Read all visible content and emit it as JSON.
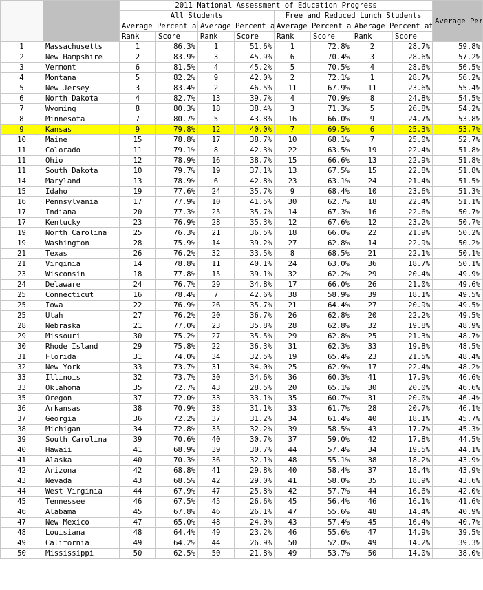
{
  "title": "2011 National Assessment of Education Progress",
  "groups": {
    "all": "All Students",
    "frl": "Free and Reduced Lunch Students",
    "avg": "Average Percent at Benchmark"
  },
  "metrics": {
    "all_basic": "Average Percent at Basic",
    "all_prof": "Average Percent at Proficient",
    "frl_basic": "Average Percent at Basic",
    "frl_prof": "Aberage Percent at Proficient"
  },
  "subheads": {
    "rank": "Rank",
    "score": "Score"
  },
  "highlight_color": "#ffff00",
  "rows": [
    {
      "rank": "1",
      "state": "Massachusetts",
      "r1": "1",
      "s1": "86.3%",
      "r2": "1",
      "s2": "51.6%",
      "r3": "1",
      "s3": "72.8%",
      "r4": "2",
      "s4": "28.7%",
      "avg": "59.8%"
    },
    {
      "rank": "2",
      "state": "New Hampshire",
      "r1": "2",
      "s1": "83.9%",
      "r2": "3",
      "s2": "45.9%",
      "r3": "6",
      "s3": "70.4%",
      "r4": "3",
      "s4": "28.6%",
      "avg": "57.2%"
    },
    {
      "rank": "3",
      "state": "Vermont",
      "r1": "6",
      "s1": "81.5%",
      "r2": "4",
      "s2": "45.2%",
      "r3": "5",
      "s3": "70.5%",
      "r4": "4",
      "s4": "28.6%",
      "avg": "56.5%"
    },
    {
      "rank": "4",
      "state": "Montana",
      "r1": "5",
      "s1": "82.2%",
      "r2": "9",
      "s2": "42.0%",
      "r3": "2",
      "s3": "72.1%",
      "r4": "1",
      "s4": "28.7%",
      "avg": "56.2%"
    },
    {
      "rank": "5",
      "state": "New Jersey",
      "r1": "3",
      "s1": "83.4%",
      "r2": "2",
      "s2": "46.5%",
      "r3": "11",
      "s3": "67.9%",
      "r4": "11",
      "s4": "23.6%",
      "avg": "55.4%"
    },
    {
      "rank": "6",
      "state": "North Dakota",
      "r1": "4",
      "s1": "82.7%",
      "r2": "13",
      "s2": "39.7%",
      "r3": "4",
      "s3": "70.9%",
      "r4": "8",
      "s4": "24.8%",
      "avg": "54.5%"
    },
    {
      "rank": "7",
      "state": "Wyoming",
      "r1": "8",
      "s1": "80.3%",
      "r2": "18",
      "s2": "38.4%",
      "r3": "3",
      "s3": "71.3%",
      "r4": "5",
      "s4": "26.8%",
      "avg": "54.2%"
    },
    {
      "rank": "8",
      "state": "Minnesota",
      "r1": "7",
      "s1": "80.7%",
      "r2": "5",
      "s2": "43.8%",
      "r3": "16",
      "s3": "66.0%",
      "r4": "9",
      "s4": "24.7%",
      "avg": "53.8%"
    },
    {
      "rank": "9",
      "state": "Kansas",
      "r1": "9",
      "s1": "79.8%",
      "r2": "12",
      "s2": "40.0%",
      "r3": "7",
      "s3": "69.5%",
      "r4": "6",
      "s4": "25.3%",
      "avg": "53.7%",
      "highlight": true
    },
    {
      "rank": "10",
      "state": "Maine",
      "r1": "15",
      "s1": "78.8%",
      "r2": "17",
      "s2": "38.7%",
      "r3": "10",
      "s3": "68.1%",
      "r4": "7",
      "s4": "25.0%",
      "avg": "52.7%"
    },
    {
      "rank": "11",
      "state": "Colorado",
      "r1": "11",
      "s1": "79.1%",
      "r2": "8",
      "s2": "42.3%",
      "r3": "22",
      "s3": "63.5%",
      "r4": "19",
      "s4": "22.4%",
      "avg": "51.8%"
    },
    {
      "rank": "11",
      "state": "Ohio",
      "r1": "12",
      "s1": "78.9%",
      "r2": "16",
      "s2": "38.7%",
      "r3": "15",
      "s3": "66.6%",
      "r4": "13",
      "s4": "22.9%",
      "avg": "51.8%"
    },
    {
      "rank": "11",
      "state": "South Dakota",
      "r1": "10",
      "s1": "79.7%",
      "r2": "19",
      "s2": "37.1%",
      "r3": "13",
      "s3": "67.5%",
      "r4": "15",
      "s4": "22.8%",
      "avg": "51.8%"
    },
    {
      "rank": "14",
      "state": "Maryland",
      "r1": "13",
      "s1": "78.9%",
      "r2": "6",
      "s2": "42.8%",
      "r3": "23",
      "s3": "63.1%",
      "r4": "24",
      "s4": "21.4%",
      "avg": "51.5%"
    },
    {
      "rank": "15",
      "state": "Idaho",
      "r1": "19",
      "s1": "77.6%",
      "r2": "24",
      "s2": "35.7%",
      "r3": "9",
      "s3": "68.4%",
      "r4": "10",
      "s4": "23.6%",
      "avg": "51.3%"
    },
    {
      "rank": "16",
      "state": "Pennsylvania",
      "r1": "17",
      "s1": "77.9%",
      "r2": "10",
      "s2": "41.5%",
      "r3": "30",
      "s3": "62.7%",
      "r4": "18",
      "s4": "22.4%",
      "avg": "51.1%"
    },
    {
      "rank": "17",
      "state": "Indiana",
      "r1": "20",
      "s1": "77.3%",
      "r2": "25",
      "s2": "35.7%",
      "r3": "14",
      "s3": "67.3%",
      "r4": "16",
      "s4": "22.6%",
      "avg": "50.7%"
    },
    {
      "rank": "17",
      "state": "Kentucky",
      "r1": "23",
      "s1": "76.9%",
      "r2": "28",
      "s2": "35.3%",
      "r3": "12",
      "s3": "67.6%",
      "r4": "12",
      "s4": "23.2%",
      "avg": "50.7%"
    },
    {
      "rank": "19",
      "state": "North Carolina",
      "r1": "25",
      "s1": "76.3%",
      "r2": "21",
      "s2": "36.5%",
      "r3": "18",
      "s3": "66.0%",
      "r4": "22",
      "s4": "21.9%",
      "avg": "50.2%"
    },
    {
      "rank": "19",
      "state": "Washington",
      "r1": "28",
      "s1": "75.9%",
      "r2": "14",
      "s2": "39.2%",
      "r3": "27",
      "s3": "62.8%",
      "r4": "14",
      "s4": "22.9%",
      "avg": "50.2%"
    },
    {
      "rank": "21",
      "state": "Texas",
      "r1": "26",
      "s1": "76.2%",
      "r2": "32",
      "s2": "33.5%",
      "r3": "8",
      "s3": "68.5%",
      "r4": "21",
      "s4": "22.1%",
      "avg": "50.1%"
    },
    {
      "rank": "21",
      "state": "Virginia",
      "r1": "14",
      "s1": "78.8%",
      "r2": "11",
      "s2": "40.1%",
      "r3": "24",
      "s3": "63.0%",
      "r4": "36",
      "s4": "18.7%",
      "avg": "50.1%"
    },
    {
      "rank": "23",
      "state": "Wisconsin",
      "r1": "18",
      "s1": "77.8%",
      "r2": "15",
      "s2": "39.1%",
      "r3": "32",
      "s3": "62.2%",
      "r4": "29",
      "s4": "20.4%",
      "avg": "49.9%"
    },
    {
      "rank": "24",
      "state": "Delaware",
      "r1": "24",
      "s1": "76.7%",
      "r2": "29",
      "s2": "34.8%",
      "r3": "17",
      "s3": "66.0%",
      "r4": "26",
      "s4": "21.0%",
      "avg": "49.6%"
    },
    {
      "rank": "25",
      "state": "Connecticut",
      "r1": "16",
      "s1": "78.4%",
      "r2": "7",
      "s2": "42.6%",
      "r3": "38",
      "s3": "58.9%",
      "r4": "39",
      "s4": "18.1%",
      "avg": "49.5%"
    },
    {
      "rank": "25",
      "state": "Iowa",
      "r1": "22",
      "s1": "76.9%",
      "r2": "26",
      "s2": "35.7%",
      "r3": "21",
      "s3": "64.4%",
      "r4": "27",
      "s4": "20.9%",
      "avg": "49.5%"
    },
    {
      "rank": "25",
      "state": "Utah",
      "r1": "27",
      "s1": "76.2%",
      "r2": "20",
      "s2": "36.7%",
      "r3": "26",
      "s3": "62.8%",
      "r4": "20",
      "s4": "22.2%",
      "avg": "49.5%"
    },
    {
      "rank": "28",
      "state": "Nebraska",
      "r1": "21",
      "s1": "77.0%",
      "r2": "23",
      "s2": "35.8%",
      "r3": "28",
      "s3": "62.8%",
      "r4": "32",
      "s4": "19.8%",
      "avg": "48.9%"
    },
    {
      "rank": "29",
      "state": "Missouri",
      "r1": "30",
      "s1": "75.2%",
      "r2": "27",
      "s2": "35.5%",
      "r3": "29",
      "s3": "62.8%",
      "r4": "25",
      "s4": "21.3%",
      "avg": "48.7%"
    },
    {
      "rank": "30",
      "state": "Rhode Island",
      "r1": "29",
      "s1": "75.8%",
      "r2": "22",
      "s2": "36.3%",
      "r3": "31",
      "s3": "62.3%",
      "r4": "33",
      "s4": "19.8%",
      "avg": "48.5%"
    },
    {
      "rank": "31",
      "state": "Florida",
      "r1": "31",
      "s1": "74.0%",
      "r2": "34",
      "s2": "32.5%",
      "r3": "19",
      "s3": "65.4%",
      "r4": "23",
      "s4": "21.5%",
      "avg": "48.4%"
    },
    {
      "rank": "32",
      "state": "New York",
      "r1": "33",
      "s1": "73.7%",
      "r2": "31",
      "s2": "34.0%",
      "r3": "25",
      "s3": "62.9%",
      "r4": "17",
      "s4": "22.4%",
      "avg": "48.2%"
    },
    {
      "rank": "33",
      "state": "Illinois",
      "r1": "32",
      "s1": "73.7%",
      "r2": "30",
      "s2": "34.6%",
      "r3": "36",
      "s3": "60.3%",
      "r4": "41",
      "s4": "17.9%",
      "avg": "46.6%"
    },
    {
      "rank": "33",
      "state": "Oklahoma",
      "r1": "35",
      "s1": "72.7%",
      "r2": "43",
      "s2": "28.5%",
      "r3": "20",
      "s3": "65.1%",
      "r4": "30",
      "s4": "20.0%",
      "avg": "46.6%"
    },
    {
      "rank": "35",
      "state": "Oregon",
      "r1": "37",
      "s1": "72.0%",
      "r2": "33",
      "s2": "33.1%",
      "r3": "35",
      "s3": "60.7%",
      "r4": "31",
      "s4": "20.0%",
      "avg": "46.4%"
    },
    {
      "rank": "36",
      "state": "Arkansas",
      "r1": "38",
      "s1": "70.9%",
      "r2": "38",
      "s2": "31.1%",
      "r3": "33",
      "s3": "61.7%",
      "r4": "28",
      "s4": "20.7%",
      "avg": "46.1%"
    },
    {
      "rank": "37",
      "state": "Georgia",
      "r1": "36",
      "s1": "72.2%",
      "r2": "37",
      "s2": "31.2%",
      "r3": "34",
      "s3": "61.4%",
      "r4": "40",
      "s4": "18.1%",
      "avg": "45.7%"
    },
    {
      "rank": "38",
      "state": "Michigan",
      "r1": "34",
      "s1": "72.8%",
      "r2": "35",
      "s2": "32.2%",
      "r3": "39",
      "s3": "58.5%",
      "r4": "43",
      "s4": "17.7%",
      "avg": "45.3%"
    },
    {
      "rank": "39",
      "state": "South Carolina",
      "r1": "39",
      "s1": "70.6%",
      "r2": "40",
      "s2": "30.7%",
      "r3": "37",
      "s3": "59.0%",
      "r4": "42",
      "s4": "17.8%",
      "avg": "44.5%"
    },
    {
      "rank": "40",
      "state": "Hawaii",
      "r1": "41",
      "s1": "68.9%",
      "r2": "39",
      "s2": "30.7%",
      "r3": "44",
      "s3": "57.4%",
      "r4": "34",
      "s4": "19.5%",
      "avg": "44.1%"
    },
    {
      "rank": "41",
      "state": "Alaska",
      "r1": "40",
      "s1": "70.3%",
      "r2": "36",
      "s2": "32.1%",
      "r3": "48",
      "s3": "55.1%",
      "r4": "38",
      "s4": "18.2%",
      "avg": "43.9%"
    },
    {
      "rank": "42",
      "state": "Arizona",
      "r1": "42",
      "s1": "68.8%",
      "r2": "41",
      "s2": "29.8%",
      "r3": "40",
      "s3": "58.4%",
      "r4": "37",
      "s4": "18.4%",
      "avg": "43.9%"
    },
    {
      "rank": "43",
      "state": "Nevada",
      "r1": "43",
      "s1": "68.5%",
      "r2": "42",
      "s2": "29.0%",
      "r3": "41",
      "s3": "58.0%",
      "r4": "35",
      "s4": "18.9%",
      "avg": "43.6%"
    },
    {
      "rank": "44",
      "state": "West Virginia",
      "r1": "44",
      "s1": "67.9%",
      "r2": "47",
      "s2": "25.8%",
      "r3": "42",
      "s3": "57.7%",
      "r4": "44",
      "s4": "16.6%",
      "avg": "42.0%"
    },
    {
      "rank": "45",
      "state": "Tennessee",
      "r1": "46",
      "s1": "67.5%",
      "r2": "45",
      "s2": "26.6%",
      "r3": "45",
      "s3": "56.4%",
      "r4": "46",
      "s4": "16.1%",
      "avg": "41.6%"
    },
    {
      "rank": "46",
      "state": "Alabama",
      "r1": "45",
      "s1": "67.8%",
      "r2": "46",
      "s2": "26.1%",
      "r3": "47",
      "s3": "55.6%",
      "r4": "48",
      "s4": "14.4%",
      "avg": "40.9%"
    },
    {
      "rank": "47",
      "state": "New Mexico",
      "r1": "47",
      "s1": "65.0%",
      "r2": "48",
      "s2": "24.0%",
      "r3": "43",
      "s3": "57.4%",
      "r4": "45",
      "s4": "16.4%",
      "avg": "40.7%"
    },
    {
      "rank": "48",
      "state": "Louisiana",
      "r1": "48",
      "s1": "64.4%",
      "r2": "49",
      "s2": "23.2%",
      "r3": "46",
      "s3": "55.6%",
      "r4": "47",
      "s4": "14.9%",
      "avg": "39.5%"
    },
    {
      "rank": "49",
      "state": "California",
      "r1": "49",
      "s1": "64.2%",
      "r2": "44",
      "s2": "26.9%",
      "r3": "50",
      "s3": "52.0%",
      "r4": "49",
      "s4": "14.2%",
      "avg": "39.3%"
    },
    {
      "rank": "50",
      "state": "Mississippi",
      "r1": "50",
      "s1": "62.5%",
      "r2": "50",
      "s2": "21.8%",
      "r3": "49",
      "s3": "53.7%",
      "r4": "50",
      "s4": "14.0%",
      "avg": "38.0%"
    }
  ]
}
